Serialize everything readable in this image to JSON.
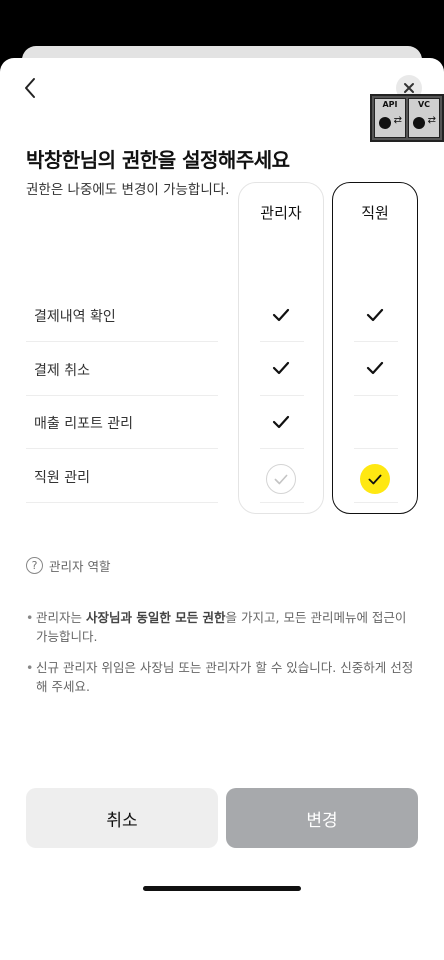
{
  "header": {
    "title": "박창한님의 권한을 설정해주세요",
    "subtitle": "권한은 나중에도 변경이 가능합니다."
  },
  "badge": {
    "left_label": "API",
    "right_label": "VC"
  },
  "columns": {
    "admin": "관리자",
    "staff": "직원"
  },
  "permissions": [
    {
      "label": "결제내역 확인",
      "admin": true,
      "staff": true
    },
    {
      "label": "결제 취소",
      "admin": true,
      "staff": true
    },
    {
      "label": "매출 리포트 관리",
      "admin": true,
      "staff": false
    },
    {
      "label": "직원 관리",
      "admin": true,
      "staff": false
    }
  ],
  "selected_role": "staff",
  "help": {
    "icon": "?",
    "title": "관리자 역할",
    "bullet1_a": "관리자는 ",
    "bullet1_b": "사장님과 동일한 모든 권한",
    "bullet1_c": "을 가지고, 모든 관리메뉴에 접근이 가능합니다.",
    "bullet2": "신규 관리자 위임은 사장님 또는 관리자가 할 수 있습니다. 신중하게 선정해 주세요."
  },
  "buttons": {
    "cancel": "취소",
    "change": "변경"
  },
  "colors": {
    "accent_yellow": "#ffe812",
    "disabled_button": "#a7a9ac"
  }
}
